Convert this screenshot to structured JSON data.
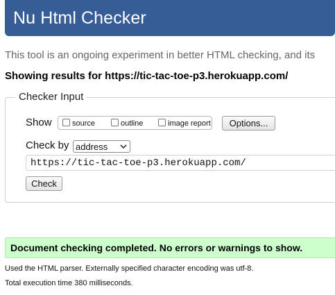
{
  "header": {
    "title": "Nu Html Checker"
  },
  "intro": "This tool is an ongoing experiment in better HTML checking, and its",
  "results_heading": "Showing results for https://tic-tac-toe-p3.herokuapp.com/",
  "checker_input": {
    "legend": "Checker Input",
    "show_label": "Show",
    "options": [
      {
        "label": "source",
        "checked": false
      },
      {
        "label": "outline",
        "checked": false
      },
      {
        "label": "image report",
        "checked": false
      }
    ],
    "options_button": "Options...",
    "check_by_label": "Check by",
    "check_by_value": "address",
    "url_value": "https://tic-tac-toe-p3.herokuapp.com/",
    "check_button": "Check"
  },
  "result": {
    "success_message": "Document checking completed. No errors or warnings to show.",
    "parser_info": "Used the HTML parser. Externally specified character encoding was utf-8.",
    "execution_time": "Total execution time 380 milliseconds."
  },
  "colors": {
    "header_bg": "#365d95",
    "success_bg": "#ccffcc"
  }
}
